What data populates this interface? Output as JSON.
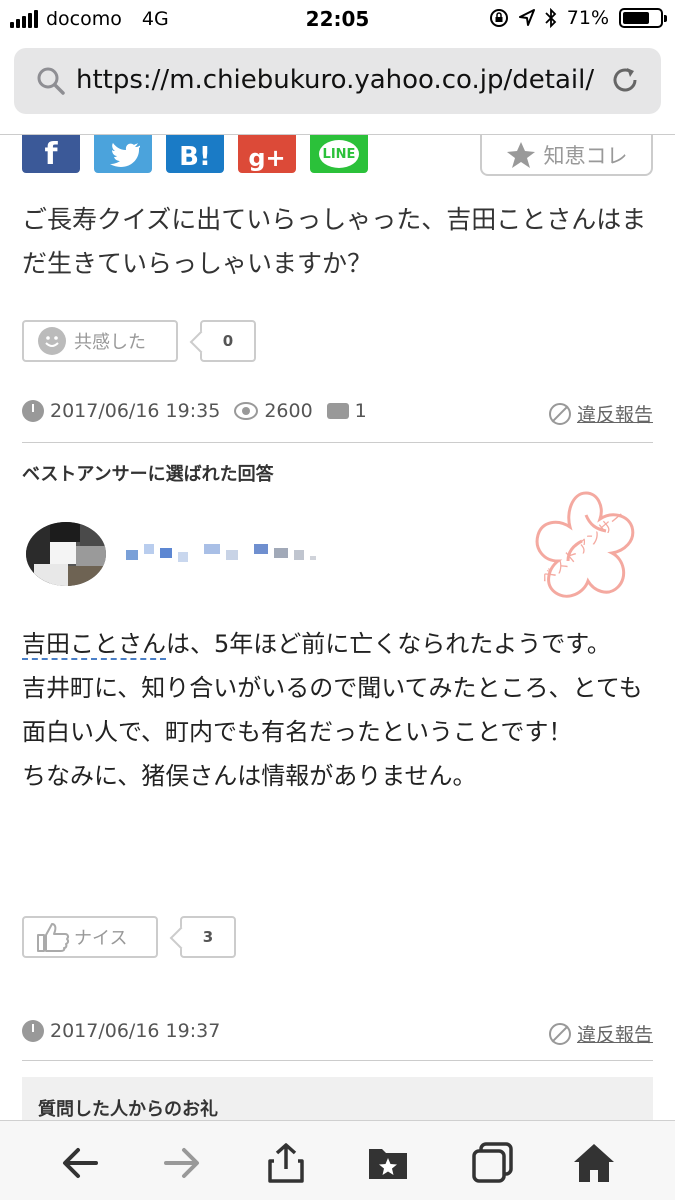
{
  "status": {
    "carrier": "docomo",
    "network": "4G",
    "time": "22:05",
    "battery": "71%",
    "battery_level": 0.71
  },
  "browser": {
    "url": "https://m.chiebukuro.yahoo.co.jp/detail/..."
  },
  "share": {
    "facebook": "f",
    "twitter": "t",
    "hatena": "B!",
    "googleplus": "g+",
    "line": "LINE",
    "chiecolle_label": "知恵コレ"
  },
  "question": {
    "text": "ご長寿クイズに出ていらっしゃった、吉田ことさんはまだ生きていらっしゃいますか？",
    "empathy_label": "共感した",
    "empathy_count": "0",
    "date": "2017/06/16 19:35",
    "views": "2600",
    "answers": "1",
    "report_label": "違反報告"
  },
  "best_answer": {
    "section_title": "ベストアンサーに選ばれた回答",
    "stamp_text": "ベストアンサー",
    "name_highlight": "吉田ことさん",
    "line1_rest": "は、5年ほど前に亡くなられたようです。",
    "line2": "吉井町に、知り合いがいるので聞いてみたところ、とても面白い人で、町内でも有名だったということです！",
    "line3": "ちなみに、猪俣さんは情報がありません。",
    "nice_label": "ナイス",
    "nice_count": "3",
    "date": "2017/06/16 19:37",
    "report_label": "違反報告"
  },
  "thanks": {
    "title": "質問した人からのお礼"
  },
  "colors": {
    "accent_link": "#4a7fc6",
    "stamp": "#f4a9a0",
    "facebook": "#3b5998",
    "twitter": "#4ba3dc",
    "hatena": "#1a7bc6",
    "googleplus": "#dc4a38",
    "line": "#2bc13a"
  },
  "toolbar_icons": [
    "back-arrow-icon",
    "forward-arrow-icon",
    "share-icon",
    "bookmarks-icon",
    "tabs-icon",
    "home-icon"
  ]
}
